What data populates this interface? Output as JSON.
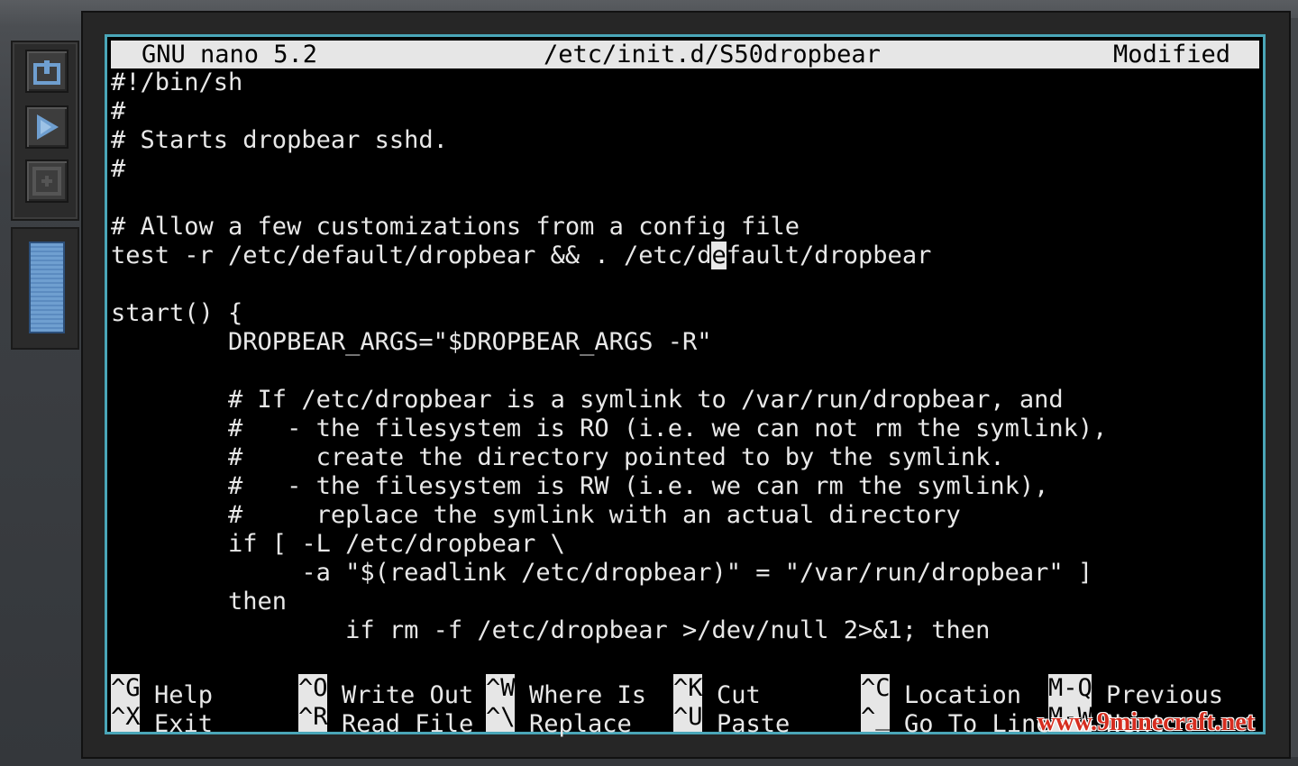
{
  "titlebar": {
    "app": "GNU nano 5.2",
    "file": "/etc/init.d/S50dropbear",
    "status": "Modified"
  },
  "editor": {
    "lines": [
      "#!/bin/sh",
      "#",
      "# Starts dropbear sshd.",
      "#",
      "",
      "# Allow a few customizations from a config file",
      "test -r /etc/default/dropbear && . /etc/default/dropbear",
      "",
      "start() {",
      "        DROPBEAR_ARGS=\"$DROPBEAR_ARGS -R\"",
      "",
      "        # If /etc/dropbear is a symlink to /var/run/dropbear, and",
      "        #   - the filesystem is RO (i.e. we can not rm the symlink),",
      "        #     create the directory pointed to by the symlink.",
      "        #   - the filesystem is RW (i.e. we can rm the symlink),",
      "        #     replace the symlink with an actual directory",
      "        if [ -L /etc/dropbear \\",
      "             -a \"$(readlink /etc/dropbear)\" = \"/var/run/dropbear\" ]",
      "        then",
      "                if rm -f /etc/dropbear >/dev/null 2>&1; then"
    ],
    "cursor_line_before": "test -r /etc/default/dropbear && . /etc/d",
    "cursor_char": "e",
    "cursor_line_after": "fault/dropbear"
  },
  "shortcuts": [
    {
      "key": "^G",
      "label": "Help"
    },
    {
      "key": "^O",
      "label": "Write Out"
    },
    {
      "key": "^W",
      "label": "Where Is"
    },
    {
      "key": "^K",
      "label": "Cut"
    },
    {
      "key": "^C",
      "label": "Location"
    },
    {
      "key": "M-Q",
      "label": "Previous"
    },
    {
      "key": "^X",
      "label": "Exit"
    },
    {
      "key": "^R",
      "label": "Read File"
    },
    {
      "key": "^\\",
      "label": "Replace"
    },
    {
      "key": "^U",
      "label": "Paste"
    },
    {
      "key": "^_",
      "label": "Go To Line"
    },
    {
      "key": "M-W",
      "label": "Next"
    }
  ],
  "watermark": "www.9minecraft.net",
  "icons": {
    "sidebar_top": "power-icon",
    "sidebar_mid": "play-icon",
    "sidebar_bottom": "stop-icon"
  },
  "colors": {
    "frame_accent": "#4aa6b8",
    "scroll_thumb": "#6f9fd0",
    "watermark": "#d62d1f"
  }
}
